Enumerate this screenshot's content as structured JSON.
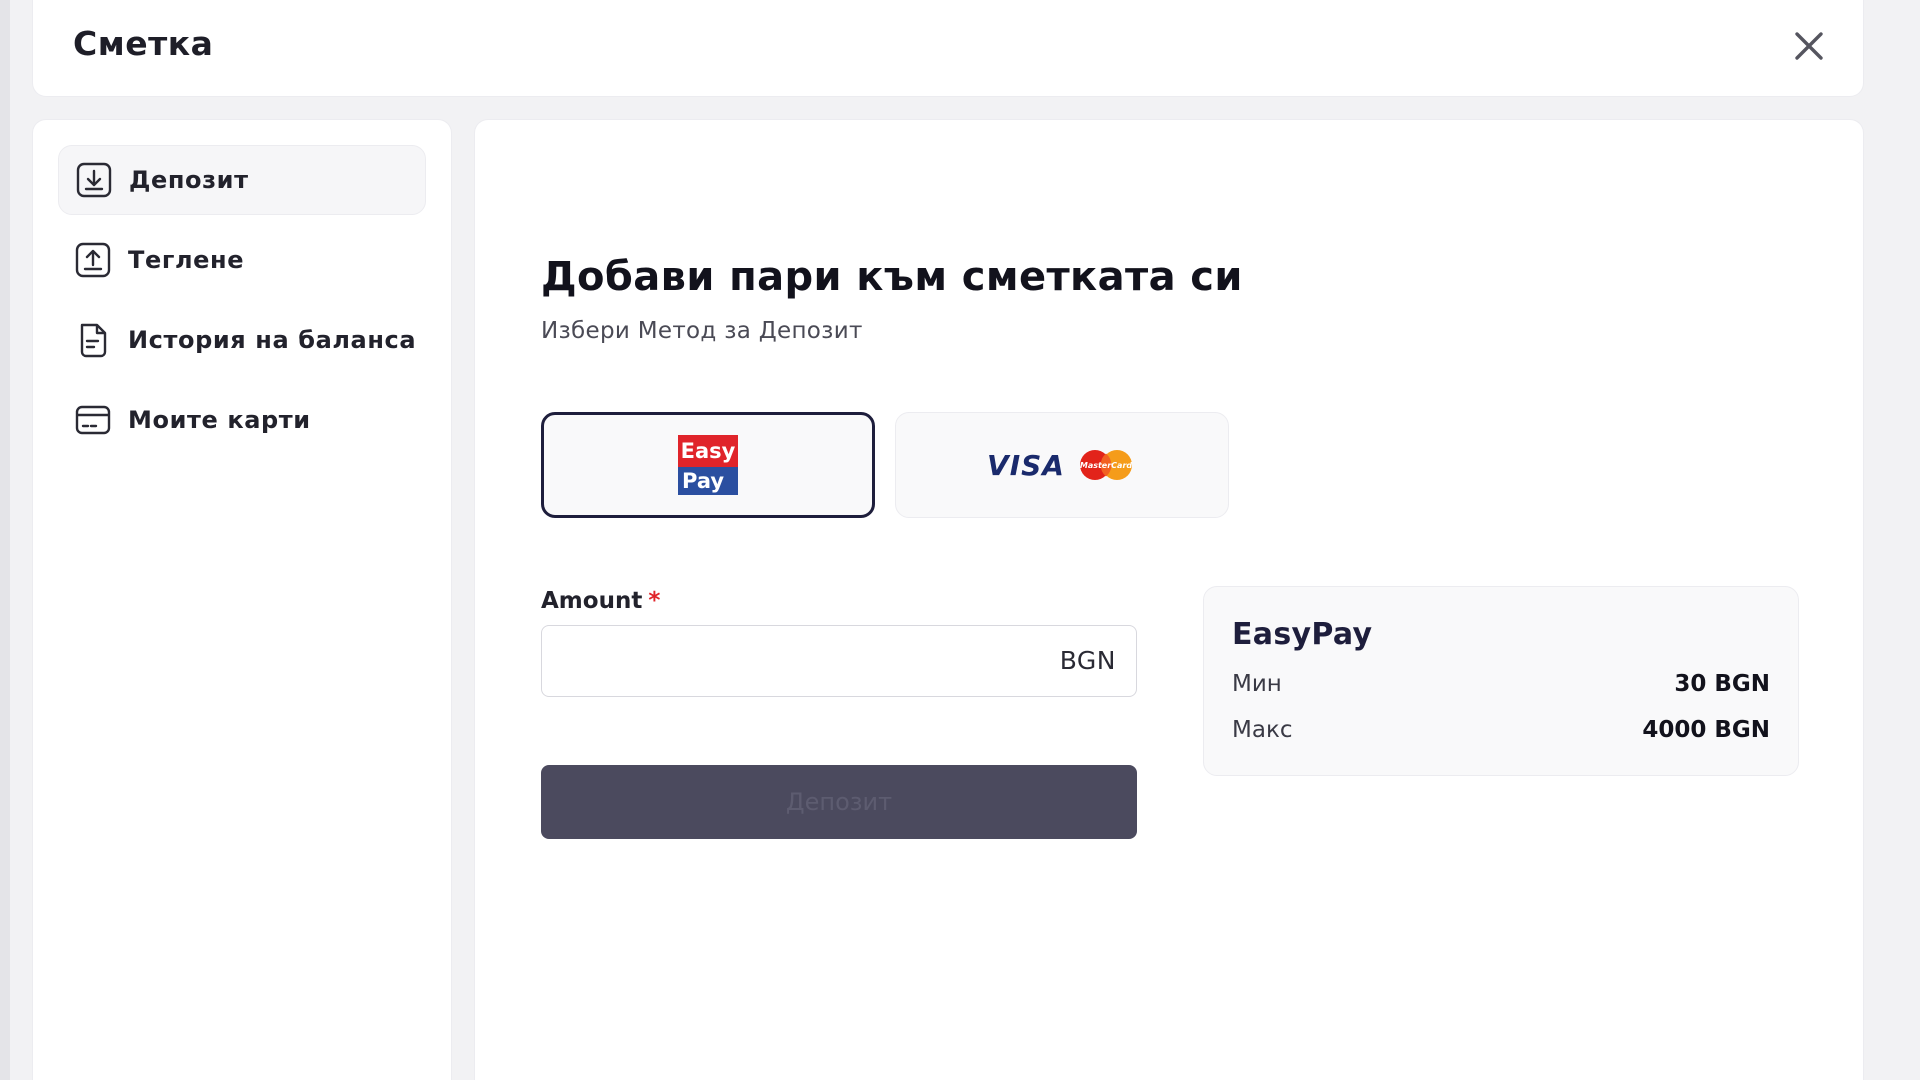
{
  "header": {
    "title": "Сметка",
    "close_icon": "close-icon"
  },
  "sidebar": {
    "items": [
      {
        "label": "Депозит",
        "icon": "download-icon",
        "active": true
      },
      {
        "label": "Теглене",
        "icon": "upload-icon",
        "active": false
      },
      {
        "label": "История на баланса",
        "icon": "document-icon",
        "active": false
      },
      {
        "label": "Моите карти",
        "icon": "card-icon",
        "active": false
      }
    ]
  },
  "main": {
    "title": "Добави пари към сметката си",
    "subtitle": "Избери Метод за Депозит",
    "methods": [
      {
        "name": "EasyPay",
        "logo_top": "Easy",
        "logo_bottom": "Pay",
        "selected": true
      },
      {
        "name": "Visa / Mastercard",
        "visa_text": "VISA",
        "mc_text": "MasterCard",
        "selected": false
      }
    ],
    "amount": {
      "label": "Amount",
      "required_mark": "*",
      "value": "",
      "currency": "BGN"
    },
    "deposit_button": "Депозит",
    "info": {
      "title": "EasyPay",
      "min_label": "Мин",
      "min_value": "30 BGN",
      "max_label": "Макс",
      "max_value": "4000 BGN"
    }
  },
  "colors": {
    "accent_dark": "#1e1e3c",
    "button_bg": "#4b4a5e",
    "required": "#e0242a",
    "easypay_red": "#e0242a",
    "easypay_blue": "#2b4fa0",
    "visa_blue": "#1a2a6c",
    "mastercard_red": "#e2231a",
    "mastercard_orange": "#f59c1a"
  }
}
